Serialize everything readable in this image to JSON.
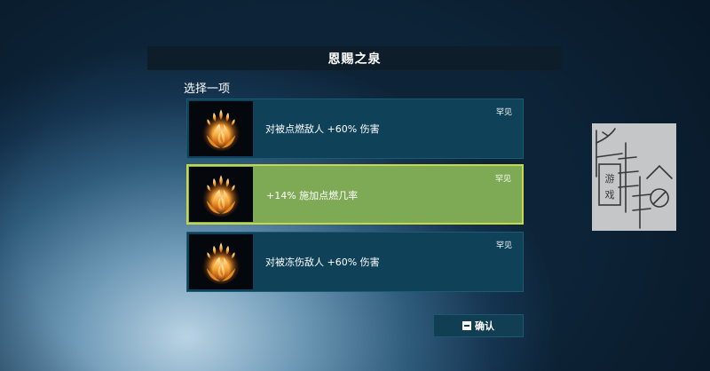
{
  "dialog": {
    "title": "恩赐之泉",
    "subtitle": "选择一项"
  },
  "options": [
    {
      "rarity": "罕见",
      "description": "对被点燃敌人 +60% 伤害",
      "icon": "ignite-fire-icon",
      "selected": false
    },
    {
      "rarity": "罕见",
      "description": "+14% 施加点燃几率",
      "icon": "ignite-fire-icon",
      "selected": true
    },
    {
      "rarity": "罕见",
      "description": "对被冻伤敌人 +60% 伤害",
      "icon": "ignite-fire-icon",
      "selected": false
    }
  ],
  "confirm": {
    "key_icon": "keyboard-key-icon",
    "label": "确认"
  },
  "colors": {
    "card_bg": "#0f4259",
    "card_selected_bg": "#7ea955",
    "card_selected_border": "#c7d84a",
    "title_bar_bg": "#0e1d2a"
  },
  "watermark": {
    "text": "游戏"
  }
}
